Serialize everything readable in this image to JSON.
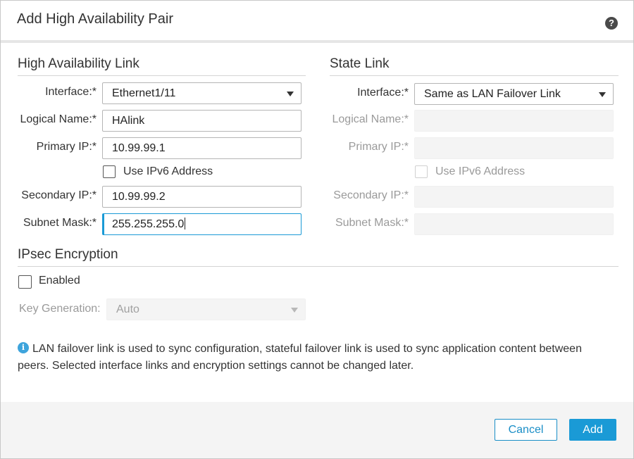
{
  "dialog": {
    "title": "Add High Availability Pair",
    "help_icon": "?"
  },
  "ha_link": {
    "section_title": "High Availability Link",
    "interface_label": "Interface:*",
    "interface_value": "Ethernet1/11",
    "logical_name_label": "Logical Name:*",
    "logical_name_value": "HAlink",
    "primary_ip_label": "Primary IP:*",
    "primary_ip_value": "10.99.99.1",
    "ipv6_label": "Use IPv6 Address",
    "secondary_ip_label": "Secondary IP:*",
    "secondary_ip_value": "10.99.99.2",
    "subnet_mask_label": "Subnet Mask:*",
    "subnet_mask_value": "255.255.255.0"
  },
  "state_link": {
    "section_title": "State Link",
    "interface_label": "Interface:*",
    "interface_value": "Same as LAN Failover Link",
    "logical_name_label": "Logical Name:*",
    "primary_ip_label": "Primary IP:*",
    "ipv6_label": "Use IPv6 Address",
    "secondary_ip_label": "Secondary IP:*",
    "subnet_mask_label": "Subnet Mask:*"
  },
  "ipsec": {
    "section_title": "IPsec Encryption",
    "enabled_label": "Enabled",
    "key_generation_label": "Key Generation:",
    "key_generation_value": "Auto"
  },
  "info": {
    "icon": "i",
    "text": "LAN failover link is used to sync configuration, stateful failover link is used to sync application content between peers. Selected interface links and encryption settings cannot be changed later."
  },
  "footer": {
    "cancel_label": "Cancel",
    "add_label": "Add"
  },
  "colors": {
    "accent": "#1a9ad6",
    "info": "#3ea4dc",
    "footer_bg": "#f4f4f4"
  }
}
